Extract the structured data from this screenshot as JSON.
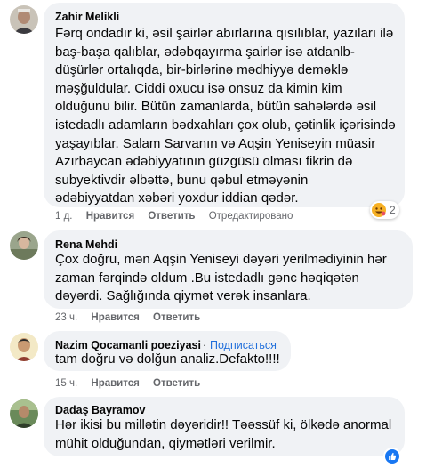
{
  "comments": [
    {
      "author": "Zahir Melikli",
      "lines": [
        "Fərq ondadır ki, əsil şairlər abırlarına qısılıblar, yazıları ilə",
        "baş-başa qalıblar, ədəbqayırma şairlər isə atdanlb-",
        "düşürlər ortalıqda, bir-birlərinə mədhiyyə deməklə",
        "məşğuldular. Ciddi oxucu isə onsuz da kimin kim",
        "olduğunu bilir. Bütün zamanlarda, bütün sahələrdə əsil",
        "istedadlı adamların bədxahları çox olub, çətinlik içərisində",
        "yaşayıblar. Salam Sarvanın və Aqşin Yeniseyin müasir",
        "Azırbaycan ədəbiyyatının güzgüsü olması fikrin də",
        "subyektivdir əlbəttə, bunu qəbul etməyənin",
        "ədəbiyyatdan xəbəri yoxdur iddian qədər."
      ],
      "time": "1 д.",
      "like": "Нравится",
      "reply": "Ответить",
      "edited": "Отредактировано",
      "reaction_count": "2"
    },
    {
      "author": "Rena Mehdi",
      "lines": [
        "Çox doğru, mən Aqşin Yeniseyi dəyəri yerilmədiyinin hər",
        "zaman fərqində oldum .Bu istedadlı gənc həqiqətən",
        "dəyərdi. Sağlığında qiymət verək insanlara."
      ],
      "time": "23 ч.",
      "like": "Нравится",
      "reply": "Ответить"
    },
    {
      "author": "Nazim Qocamanli poeziyasi",
      "separator": "·",
      "follow": "Подписаться",
      "lines": [
        "tam doğru və dolğun analiz.Defakto!!!!"
      ],
      "time": "15 ч.",
      "like": "Нравится",
      "reply": "Ответить"
    },
    {
      "author": "Dadaş Bayramov",
      "lines": [
        "Hər ikisi bu millətin dəyəridir!! Təəssüf ki, ölkədə anormal",
        "mühit olduğundan, qiymətləri verilmir."
      ]
    }
  ],
  "icons": {
    "reaction": "haha-emoji-icon",
    "like": "like-thumb-icon"
  },
  "colors": {
    "bubble": "#f0f2f5",
    "meta": "#65676b",
    "link": "#216fdb",
    "like_blue": "#1877f2"
  }
}
